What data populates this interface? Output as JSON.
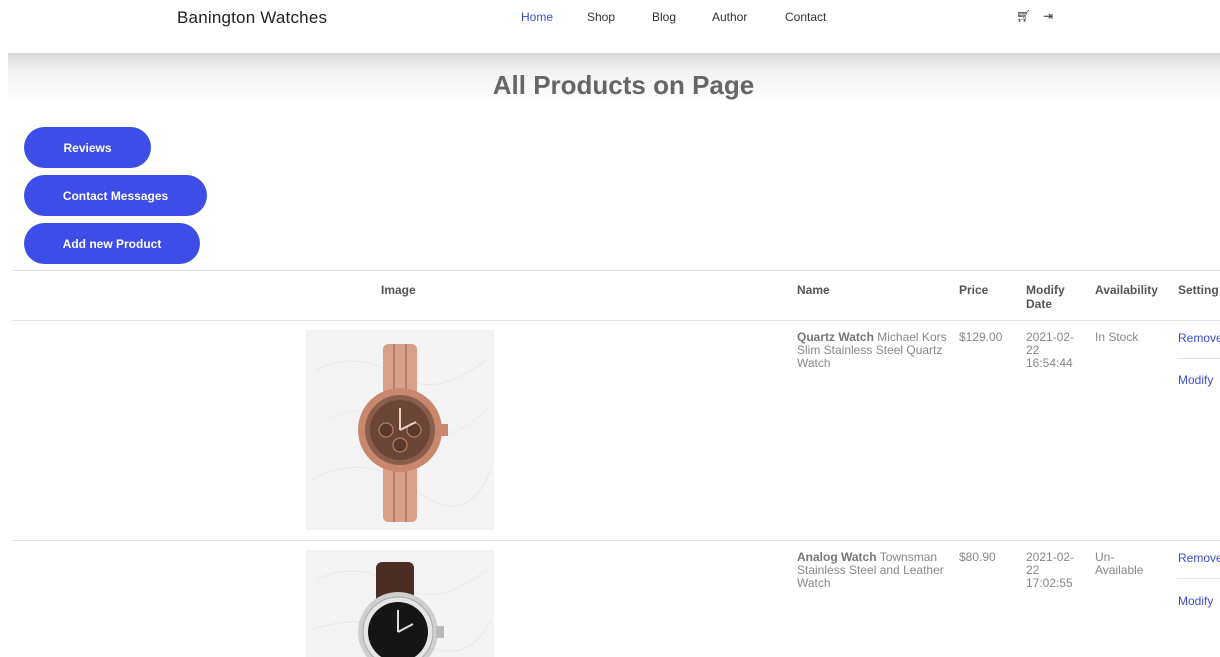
{
  "header": {
    "brand": "Banington Watches",
    "nav": [
      "Home",
      "Shop",
      "Blog",
      "Author",
      "Contact"
    ],
    "cart_icon": "cart-icon",
    "login_icon": "login-arrow-icon"
  },
  "page_title": "All Products on Page",
  "admin_buttons": {
    "reviews": "Reviews",
    "contact_messages": "Contact Messages",
    "add_product": "Add new Product"
  },
  "table": {
    "headers": {
      "image": "Image",
      "name": "Name",
      "price": "Price",
      "modify_date": "Modify Date",
      "availability": "Availability",
      "settings": "Setting"
    },
    "rows": [
      {
        "name_bold": "Quartz Watch",
        "name_rest": "Michael Kors Slim Stainless Steel Quartz Watch",
        "price": "$129.00",
        "date": "2021-02-22 16:54:44",
        "availability": "In Stock",
        "remove": "Remove",
        "modify": "Modify"
      },
      {
        "name_bold": "Analog Watch",
        "name_rest": "Townsman Stainless Steel and Leather Watch",
        "price": "$80.90",
        "date": "2021-02-22 17:02:55",
        "availability": "Un-Available",
        "remove": "Remove",
        "modify": "Modify"
      }
    ]
  },
  "colors": {
    "accent": "#3d4de8",
    "link": "#3b4fd6"
  }
}
